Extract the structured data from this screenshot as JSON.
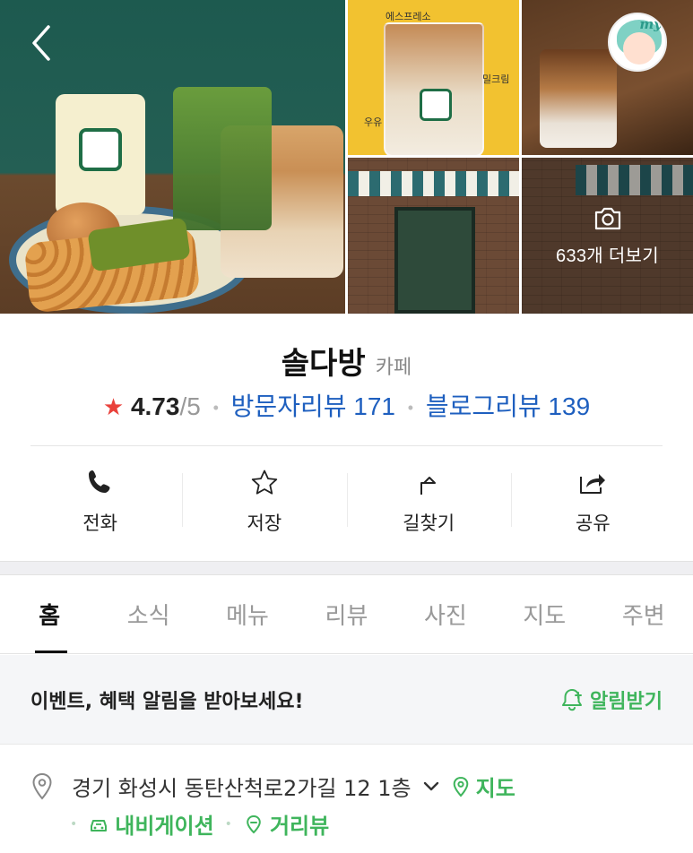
{
  "gallery": {
    "more_photos_label": "633개 더보기",
    "poster_text": {
      "espresso": "에스프레소",
      "cream": "밀크림",
      "milk": "우유"
    },
    "avatar_badge": "my"
  },
  "place": {
    "name": "솔다방",
    "category": "카페",
    "rating": "4.73",
    "rating_max": "/5",
    "visitor_reviews": "방문자리뷰 171",
    "blog_reviews": "블로그리뷰 139"
  },
  "actions": [
    {
      "label": "전화",
      "icon": "phone-icon"
    },
    {
      "label": "저장",
      "icon": "star-icon"
    },
    {
      "label": "길찾기",
      "icon": "directions-icon"
    },
    {
      "label": "공유",
      "icon": "share-icon"
    }
  ],
  "tabs": [
    {
      "label": "홈",
      "active": true
    },
    {
      "label": "소식"
    },
    {
      "label": "메뉴"
    },
    {
      "label": "리뷰"
    },
    {
      "label": "사진"
    },
    {
      "label": "지도"
    },
    {
      "label": "주변"
    }
  ],
  "notice": {
    "text": "이벤트, 혜택 알림을 받아보세요!",
    "button": "알림받기"
  },
  "address": {
    "text": "경기 화성시 동탄산척로2가길 12 1층",
    "map_link": "지도",
    "navigation_link": "내비게이션",
    "street_view_link": "거리뷰"
  },
  "colors": {
    "accent_green": "#3fb55c",
    "link_blue": "#1e5fbf",
    "star_red": "#e9413b"
  }
}
